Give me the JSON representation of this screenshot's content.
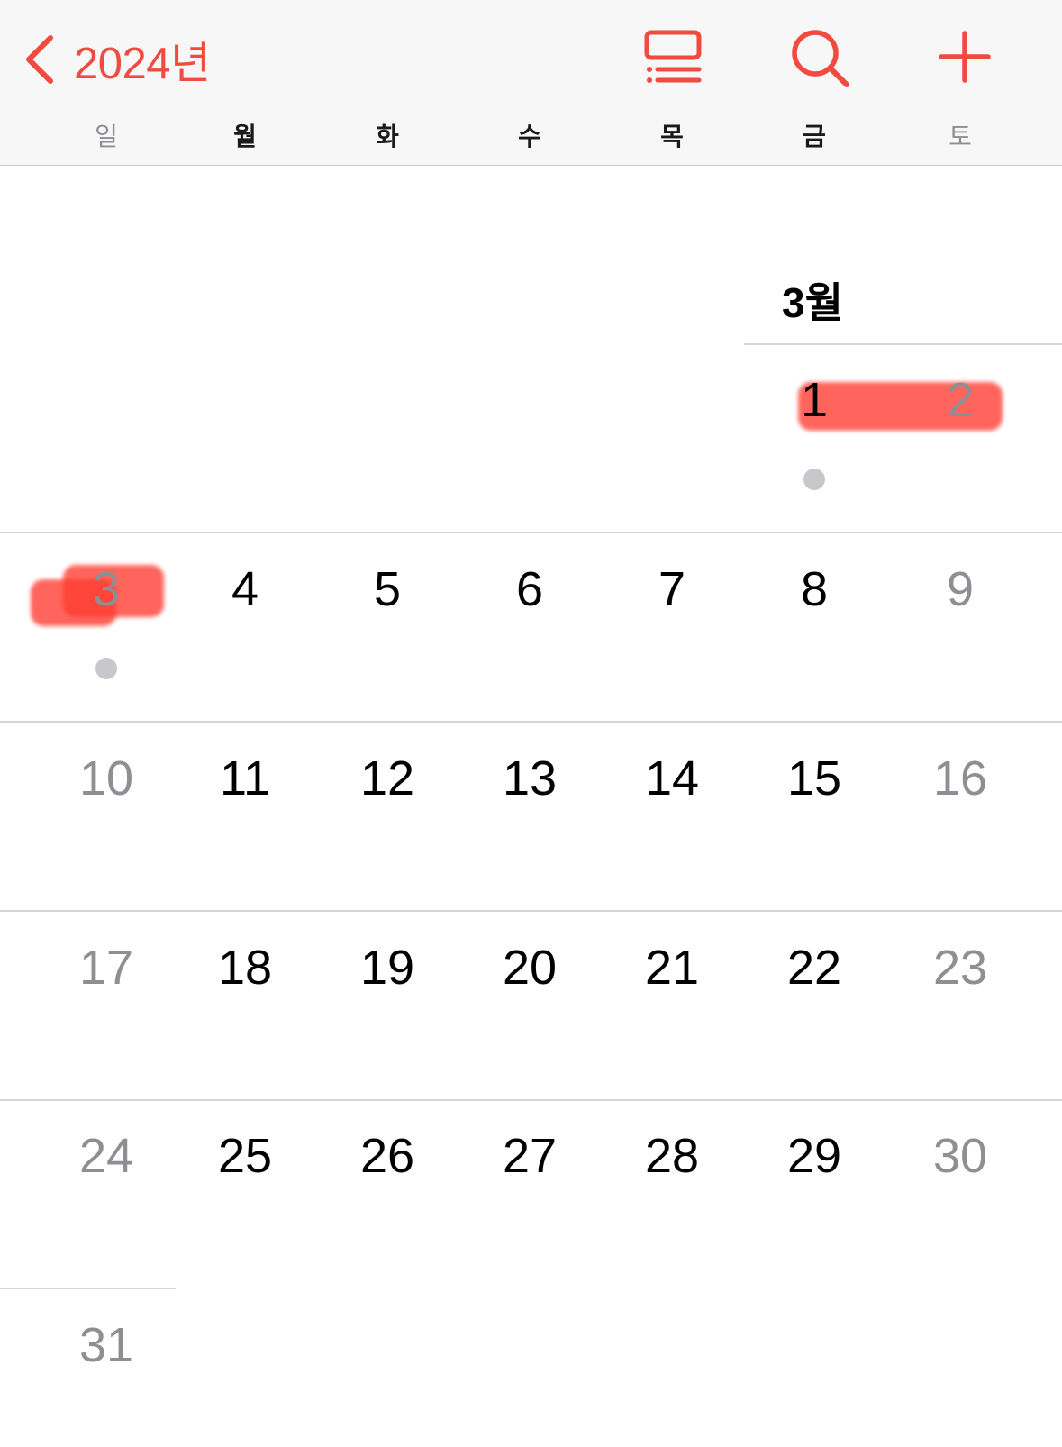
{
  "header": {
    "back_label": "2024년",
    "weekdays": [
      "일",
      "월",
      "화",
      "수",
      "목",
      "금",
      "토"
    ]
  },
  "month": {
    "title": "3월"
  },
  "days": [
    "1",
    "2",
    "3",
    "4",
    "5",
    "6",
    "7",
    "8",
    "9",
    "10",
    "11",
    "12",
    "13",
    "14",
    "15",
    "16",
    "17",
    "18",
    "19",
    "20",
    "21",
    "22",
    "23",
    "24",
    "25",
    "26",
    "27",
    "28",
    "29",
    "30",
    "31"
  ],
  "colors": {
    "accent": "#f14a3f",
    "weekend": "#8e8e93",
    "dot": "#c7c7cc",
    "divider": "#d6d6d8"
  },
  "icons": [
    "chevron-left-icon",
    "list-view-icon",
    "search-icon",
    "plus-icon"
  ]
}
